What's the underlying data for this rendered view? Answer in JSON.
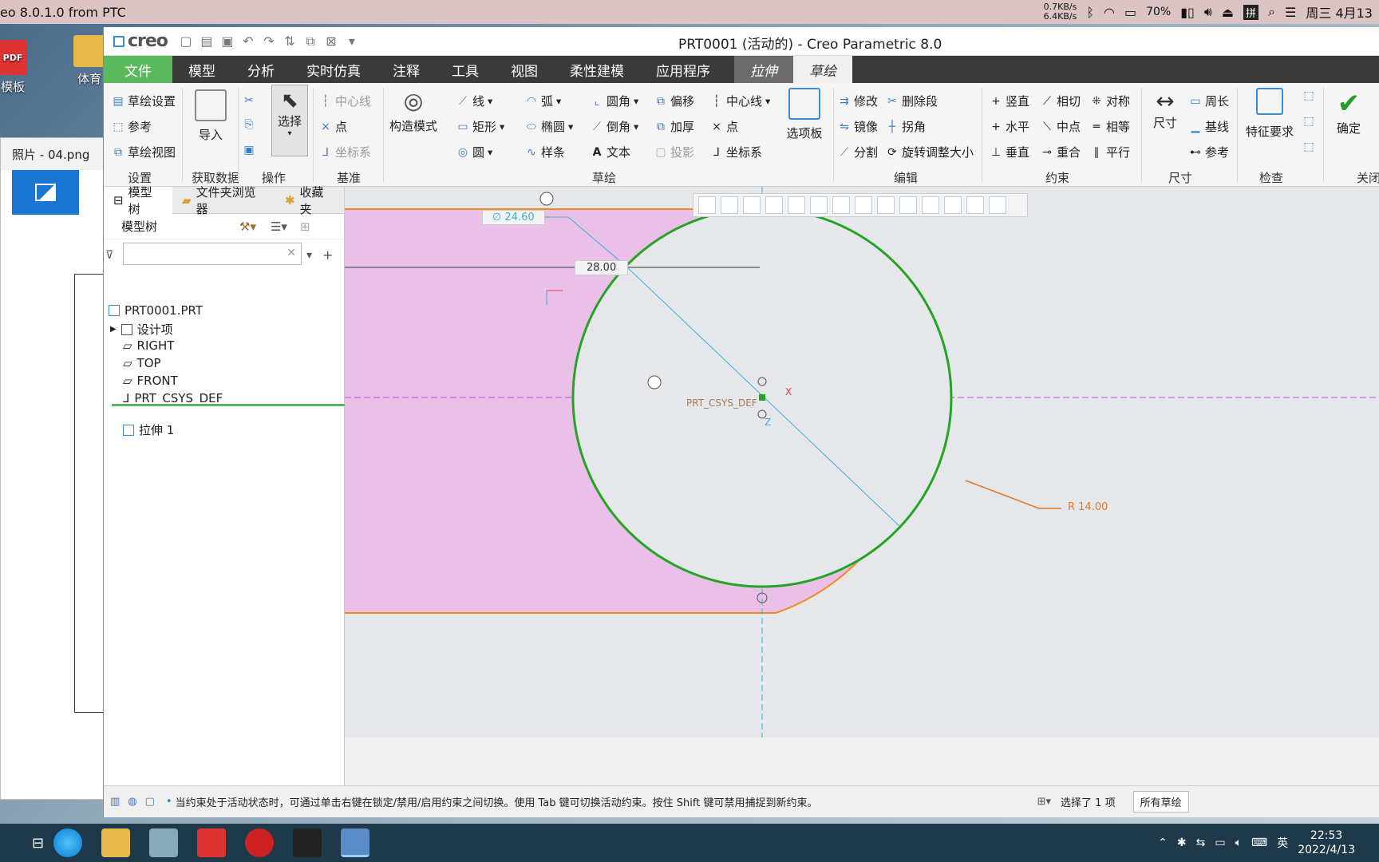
{
  "mac_menubar": {
    "app_title": "eo 8.0.1.0 from PTC",
    "net_up": "0.7KB/s",
    "net_down": "6.4KB/s",
    "battery": "70%",
    "input_lang": "拼",
    "clock": "周三 4月13"
  },
  "desktop": {
    "icons": [
      {
        "label": "模板"
      },
      {
        "label": "体育"
      }
    ],
    "photos_title": "照片 - 04.png"
  },
  "window": {
    "logo": "creo",
    "title": "PRT0001 (活动的) - Creo Parametric 8.0"
  },
  "menu_tabs": [
    "文件",
    "模型",
    "分析",
    "实时仿真",
    "注释",
    "工具",
    "视图",
    "柔性建模",
    "应用程序",
    "拉伸",
    "草绘"
  ],
  "ribbon": {
    "setup": {
      "items": [
        "草绘设置",
        "参考",
        "草绘视图"
      ],
      "label": "设置"
    },
    "get_data": {
      "button": "导入",
      "label": "获取数据"
    },
    "operations": {
      "button": "选择",
      "label": "操作"
    },
    "datum": {
      "items": [
        "中心线",
        "点",
        "坐标系"
      ],
      "label": "基准"
    },
    "sketching": {
      "construction": "构造模式",
      "col1": [
        "线",
        "矩形",
        "圆"
      ],
      "col2": [
        "弧",
        "椭圆",
        "样条"
      ],
      "col3": [
        "圆角",
        "倒角",
        "文本"
      ],
      "col4": [
        "偏移",
        "加厚",
        "投影"
      ],
      "col5": [
        "中心线",
        "点",
        "坐标系"
      ],
      "palette": "选项板",
      "label": "草绘"
    },
    "editing": {
      "items": [
        "修改",
        "删除段",
        "镜像",
        "拐角",
        "分割",
        "旋转调整大小"
      ],
      "label": "编辑"
    },
    "constrain": {
      "items": [
        "竖直",
        "相切",
        "对称",
        "水平",
        "中点",
        "相等",
        "垂直",
        "重合",
        "平行"
      ],
      "label": "约束"
    },
    "dimension": {
      "button": "尺寸",
      "items": [
        "周长",
        "基线",
        "参考"
      ],
      "label": "尺寸"
    },
    "inspect": {
      "button": "特征要求",
      "label": "检查"
    },
    "close": {
      "button": "确定",
      "label": "关闭"
    }
  },
  "left_panel": {
    "tabs": [
      "模型树",
      "文件夹浏览器",
      "收藏夹"
    ],
    "tree_header": "模型树",
    "filter_placeholder": "",
    "nodes": [
      "PRT0001.PRT",
      "设计项",
      "RIGHT",
      "TOP",
      "FRONT",
      "PRT_CSYS_DEF",
      "拉伸 1"
    ]
  },
  "sketch": {
    "dim_diameter": "∅ 24.60",
    "dim_horizontal": "28.00",
    "dim_radius": "R 14.00",
    "csys_label": "PRT_CSYS_DEF",
    "axis_x": "X",
    "axis_z": "Z",
    "colors": {
      "fill": "#ebc0e8",
      "circle": "#23a523",
      "arc": "#f08a20",
      "dimension": "#3ab0d8"
    }
  },
  "status": {
    "message": "当约束处于活动状态时，可通过单击右键在锁定/禁用/启用约束之间切换。使用 Tab 键可切换活动约束。按住 Shift 键可禁用捕捉到新约束。",
    "selection": "选择了 1 项",
    "filter": "所有草绘"
  },
  "taskbar": {
    "ime": "英",
    "time": "22:53",
    "date": "2022/4/13"
  }
}
